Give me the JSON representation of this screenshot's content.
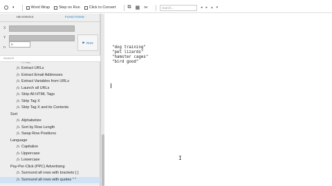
{
  "toolbar": {
    "word_wrap_label": "Word Wrap",
    "step_label": "Step on Run",
    "click_label": "Click to Convert",
    "search_placeholder": "search..."
  },
  "sidebar": {
    "tabs": [
      "HEADINGS",
      "FUNCTIONS"
    ],
    "active_tab": "FUNCTIONS",
    "x_label": "X",
    "y_label": "Y",
    "n_label": "n",
    "n_value": "0",
    "run_label": "RUN",
    "filter_placeholder": "Search",
    "cut_top_label": "HTML",
    "items": [
      {
        "type": "item",
        "label": "Extract URLs"
      },
      {
        "type": "item",
        "label": "Extract Email Addresses"
      },
      {
        "type": "item",
        "label": "Extract Variables from URLs"
      },
      {
        "type": "item",
        "label": "Launch all URLs"
      },
      {
        "type": "item",
        "label": "Strip All HTML Tags"
      },
      {
        "type": "item",
        "label": "Strip Tag X"
      },
      {
        "type": "item",
        "label": "Strip Tag X and its Contents"
      },
      {
        "type": "heading",
        "label": "Sort"
      },
      {
        "type": "item",
        "label": "Alphabetize"
      },
      {
        "type": "item",
        "label": "Sort by Row Length"
      },
      {
        "type": "item",
        "label": "Swap Row Positions"
      },
      {
        "type": "heading",
        "label": "Language"
      },
      {
        "type": "item",
        "label": "Capitalize"
      },
      {
        "type": "item",
        "label": "Uppercase"
      },
      {
        "type": "item",
        "label": "Lowercase"
      },
      {
        "type": "heading",
        "label": "Pay-Per-Click (PPC) Advertising"
      },
      {
        "type": "item",
        "label": "Surround all rows with brackets [ ]"
      },
      {
        "type": "item",
        "label": "Surround all rows with quotes \" \"",
        "selected": true
      }
    ]
  },
  "editor": {
    "lines": [
      "\"dog training\"",
      "\"pet lizards\"",
      "\"hamster cages\"",
      "\"bird good\""
    ]
  },
  "colors": {
    "accent": "#2e8bd0",
    "selected_row": "#cfe3f5",
    "sidebar_bg": "#eeeeee"
  }
}
